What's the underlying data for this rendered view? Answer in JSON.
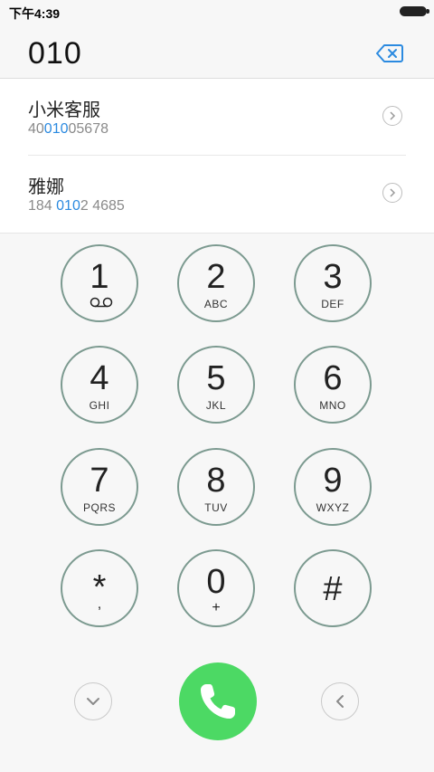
{
  "status_bar": {
    "time": "下午4:39"
  },
  "dialer": {
    "number": "010"
  },
  "results": [
    {
      "name": "小米客服",
      "number_pre": "40",
      "number_match": "010",
      "number_post": "05678"
    },
    {
      "name": "雅娜",
      "number_pre": "184 ",
      "number_match": "010",
      "number_post": "2 4685"
    }
  ],
  "keys": [
    {
      "digit": "1",
      "letters": ""
    },
    {
      "digit": "2",
      "letters": "ABC"
    },
    {
      "digit": "3",
      "letters": "DEF"
    },
    {
      "digit": "4",
      "letters": "GHI"
    },
    {
      "digit": "5",
      "letters": "JKL"
    },
    {
      "digit": "6",
      "letters": "MNO"
    },
    {
      "digit": "7",
      "letters": "PQRS"
    },
    {
      "digit": "8",
      "letters": "TUV"
    },
    {
      "digit": "9",
      "letters": "WXYZ"
    },
    {
      "digit": "*",
      "letters": ","
    },
    {
      "digit": "0",
      "letters": "+"
    },
    {
      "digit": "#",
      "letters": ""
    }
  ],
  "colors": {
    "call_button": "#4cd964",
    "highlight": "#2b8ae0",
    "key_ring": "#7c9a90"
  },
  "icons": {
    "backspace": "backspace-icon",
    "voicemail": "voicemail-icon",
    "collapse": "chevron-down-icon",
    "call": "phone-icon",
    "back": "chevron-left-icon"
  }
}
